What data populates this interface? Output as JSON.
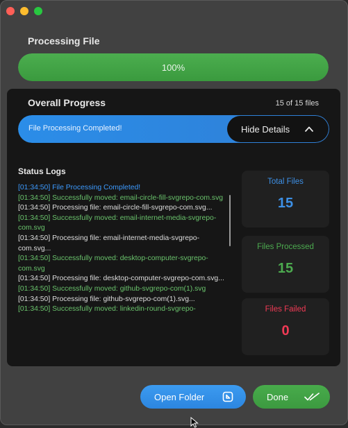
{
  "processing": {
    "title": "Processing File",
    "percent_label": "100%",
    "progress": 1.0
  },
  "overall": {
    "title": "Overall Progress",
    "files_count": "15 of 15 files",
    "status": "File Processing Completed!",
    "progress": 1.0,
    "hide_details_label": "Hide Details"
  },
  "logs": {
    "title": "Status Logs",
    "lines": [
      {
        "text": "[01:34:50] File Processing Completed!",
        "type": "info"
      },
      {
        "text": "[01:34:50] Successfully moved: email-circle-fill-svgrepo-com.svg",
        "type": "success"
      },
      {
        "text": "[01:34:50] Processing file: email-circle-fill-svgrepo-com.svg...",
        "type": "plain"
      },
      {
        "text": "[01:34:50] Successfully moved: email-internet-media-svgrepo-com.svg",
        "type": "success"
      },
      {
        "text": "[01:34:50] Processing file: email-internet-media-svgrepo-com.svg...",
        "type": "plain"
      },
      {
        "text": "[01:34:50] Successfully moved: desktop-computer-svgrepo-com.svg",
        "type": "success"
      },
      {
        "text": "[01:34:50] Processing file: desktop-computer-svgrepo-com.svg...",
        "type": "plain"
      },
      {
        "text": "[01:34:50] Successfully moved: github-svgrepo-com(1).svg",
        "type": "success"
      },
      {
        "text": "[01:34:50] Processing file: github-svgrepo-com(1).svg...",
        "type": "plain"
      },
      {
        "text": "[01:34:50] Successfully moved: linkedin-round-svgrepo-",
        "type": "success"
      }
    ]
  },
  "stats": {
    "total": {
      "label": "Total Files",
      "value": "15"
    },
    "processed": {
      "label": "Files Processed",
      "value": "15"
    },
    "failed": {
      "label": "Files Failed",
      "value": "0"
    }
  },
  "buttons": {
    "open_folder": "Open Folder",
    "done": "Done"
  },
  "icons": {
    "open_folder": "open-external-icon",
    "done": "double-check-icon",
    "hide_details": "chevron-up-icon"
  },
  "colors": {
    "success_green": "#4caa4f",
    "accent_blue": "#2c86e0",
    "failed_red": "#f03a55"
  }
}
